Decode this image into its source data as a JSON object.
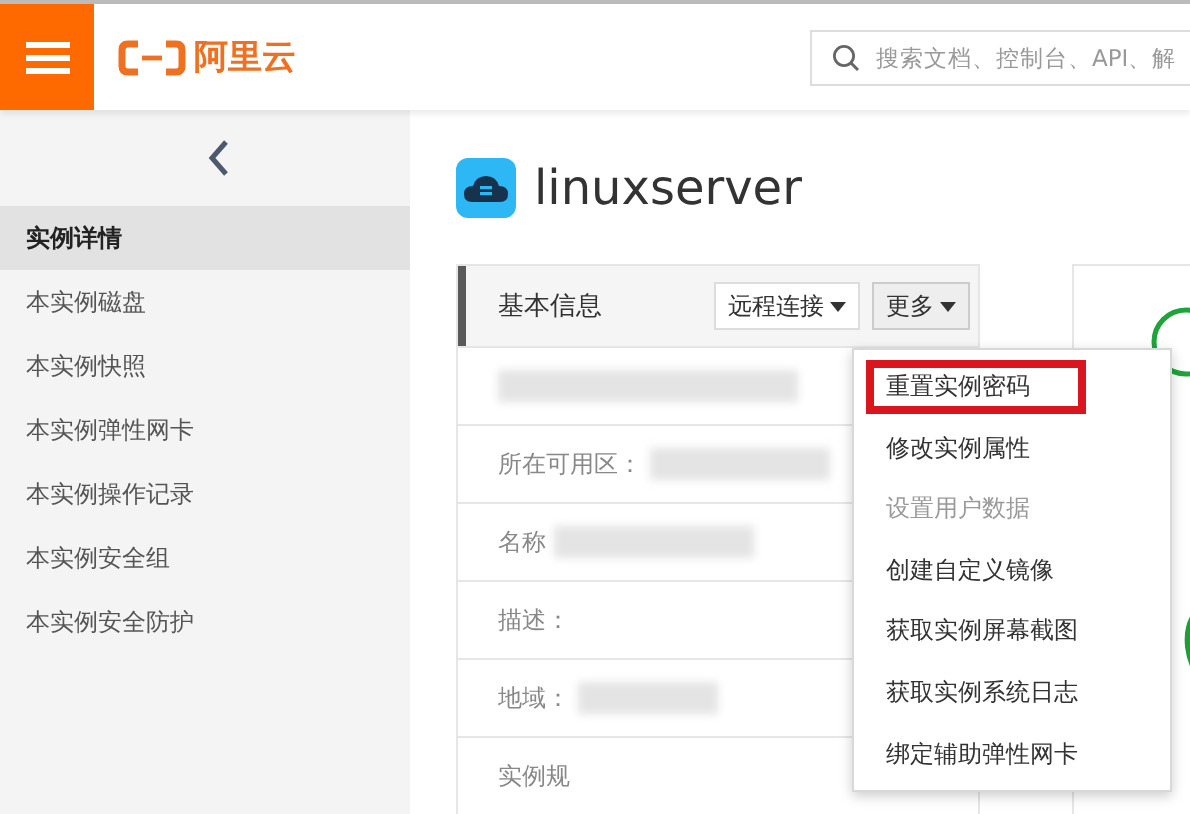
{
  "header": {
    "logo": "阿里云",
    "search": {
      "placeholder": "搜索文档、控制台、API、解"
    }
  },
  "sidebar": {
    "items": [
      {
        "label": "实例详情",
        "selected": true
      },
      {
        "label": "本实例磁盘",
        "selected": false
      },
      {
        "label": "本实例快照",
        "selected": false
      },
      {
        "label": "本实例弹性网卡",
        "selected": false
      },
      {
        "label": "本实例操作记录",
        "selected": false
      },
      {
        "label": "本实例安全组",
        "selected": false
      },
      {
        "label": "本实例安全防护",
        "selected": false
      }
    ]
  },
  "page_title": "linuxserver",
  "info_card": {
    "title": "基本信息",
    "buttons": [
      "远程连接",
      "更多"
    ],
    "rows": [
      {
        "kind": "blurred"
      },
      {
        "label": "所在可用区：",
        "kind": "blurred"
      },
      {
        "label": "名称",
        "kind": "blurred"
      },
      {
        "label": "描述：",
        "kind": "plain"
      },
      {
        "label": "地域：",
        "kind": "blurred"
      },
      {
        "label": "实例规",
        "kind": "plain"
      }
    ]
  },
  "menu": {
    "items": [
      {
        "label": "重置实例密码",
        "disabled": false,
        "highlighted": true
      },
      {
        "label": "修改实例属性",
        "disabled": false,
        "highlighted": false
      },
      {
        "label": "设置用户数据",
        "disabled": true,
        "highlighted": false
      },
      {
        "label": "创建自定义镜像",
        "disabled": false,
        "highlighted": false
      },
      {
        "label": "获取实例屏幕截图",
        "disabled": false,
        "highlighted": false
      },
      {
        "label": "获取实例系统日志",
        "disabled": false,
        "highlighted": false
      },
      {
        "label": "绑定辅助弹性网卡",
        "disabled": false,
        "highlighted": false
      }
    ]
  }
}
